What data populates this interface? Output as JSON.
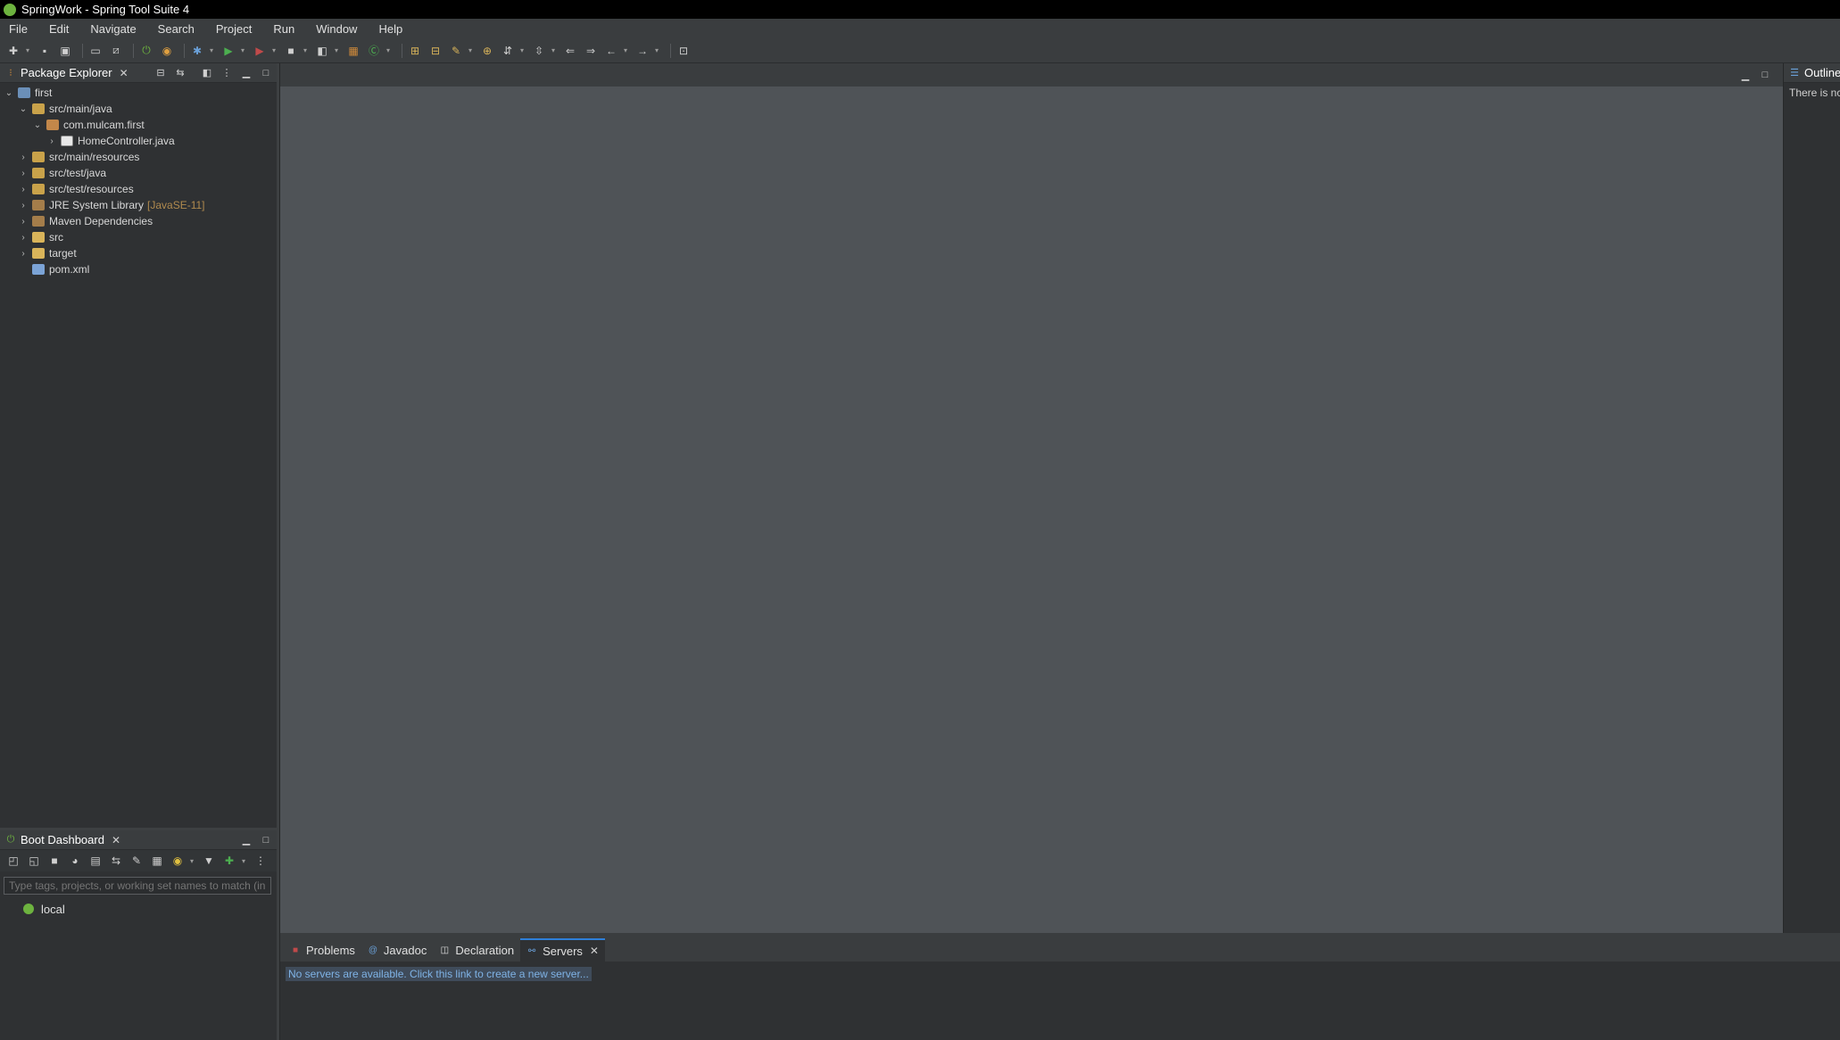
{
  "window": {
    "title": "SpringWork - Spring Tool Suite 4"
  },
  "menu": [
    "File",
    "Edit",
    "Navigate",
    "Search",
    "Project",
    "Run",
    "Window",
    "Help"
  ],
  "package_explorer": {
    "tab_label": "Package Explorer",
    "tree": [
      {
        "label": "first",
        "indent": 0,
        "chevron": "⌄",
        "icon": "ico-project"
      },
      {
        "label": "src/main/java",
        "indent": 1,
        "chevron": "⌄",
        "icon": "ico-srcfolder"
      },
      {
        "label": "com.mulcam.first",
        "indent": 2,
        "chevron": "⌄",
        "icon": "ico-package"
      },
      {
        "label": "HomeController.java",
        "indent": 3,
        "chevron": "›",
        "icon": "ico-java"
      },
      {
        "label": "src/main/resources",
        "indent": 1,
        "chevron": "›",
        "icon": "ico-srcfolder"
      },
      {
        "label": "src/test/java",
        "indent": 1,
        "chevron": "›",
        "icon": "ico-srcfolder"
      },
      {
        "label": "src/test/resources",
        "indent": 1,
        "chevron": "›",
        "icon": "ico-srcfolder"
      },
      {
        "label": "JRE System Library",
        "decoration": "[JavaSE-11]",
        "indent": 1,
        "chevron": "›",
        "icon": "ico-lib"
      },
      {
        "label": "Maven Dependencies",
        "indent": 1,
        "chevron": "›",
        "icon": "ico-lib"
      },
      {
        "label": "src",
        "indent": 1,
        "chevron": "›",
        "icon": "ico-folder"
      },
      {
        "label": "target",
        "indent": 1,
        "chevron": "›",
        "icon": "ico-folder"
      },
      {
        "label": "pom.xml",
        "indent": 1,
        "chevron": "",
        "icon": "ico-xml"
      }
    ]
  },
  "boot_dashboard": {
    "tab_label": "Boot Dashboard",
    "search_placeholder": "Type tags, projects, or working set names to match (in",
    "local_label": "local"
  },
  "outline": {
    "tab_label": "Outline",
    "message": "There is nc"
  },
  "bottom_panel": {
    "tabs": [
      {
        "label": "Problems",
        "icon": "problems-icon",
        "active": false
      },
      {
        "label": "Javadoc",
        "icon": "javadoc-icon",
        "active": false
      },
      {
        "label": "Declaration",
        "icon": "declaration-icon",
        "active": false
      },
      {
        "label": "Servers",
        "icon": "servers-icon",
        "active": true
      }
    ],
    "servers_message": "No servers are available. Click this link to create a new server..."
  },
  "colors": {
    "accent": "#2e7fd8",
    "spring_green": "#6db33f",
    "editor_bg": "#4f5357"
  }
}
